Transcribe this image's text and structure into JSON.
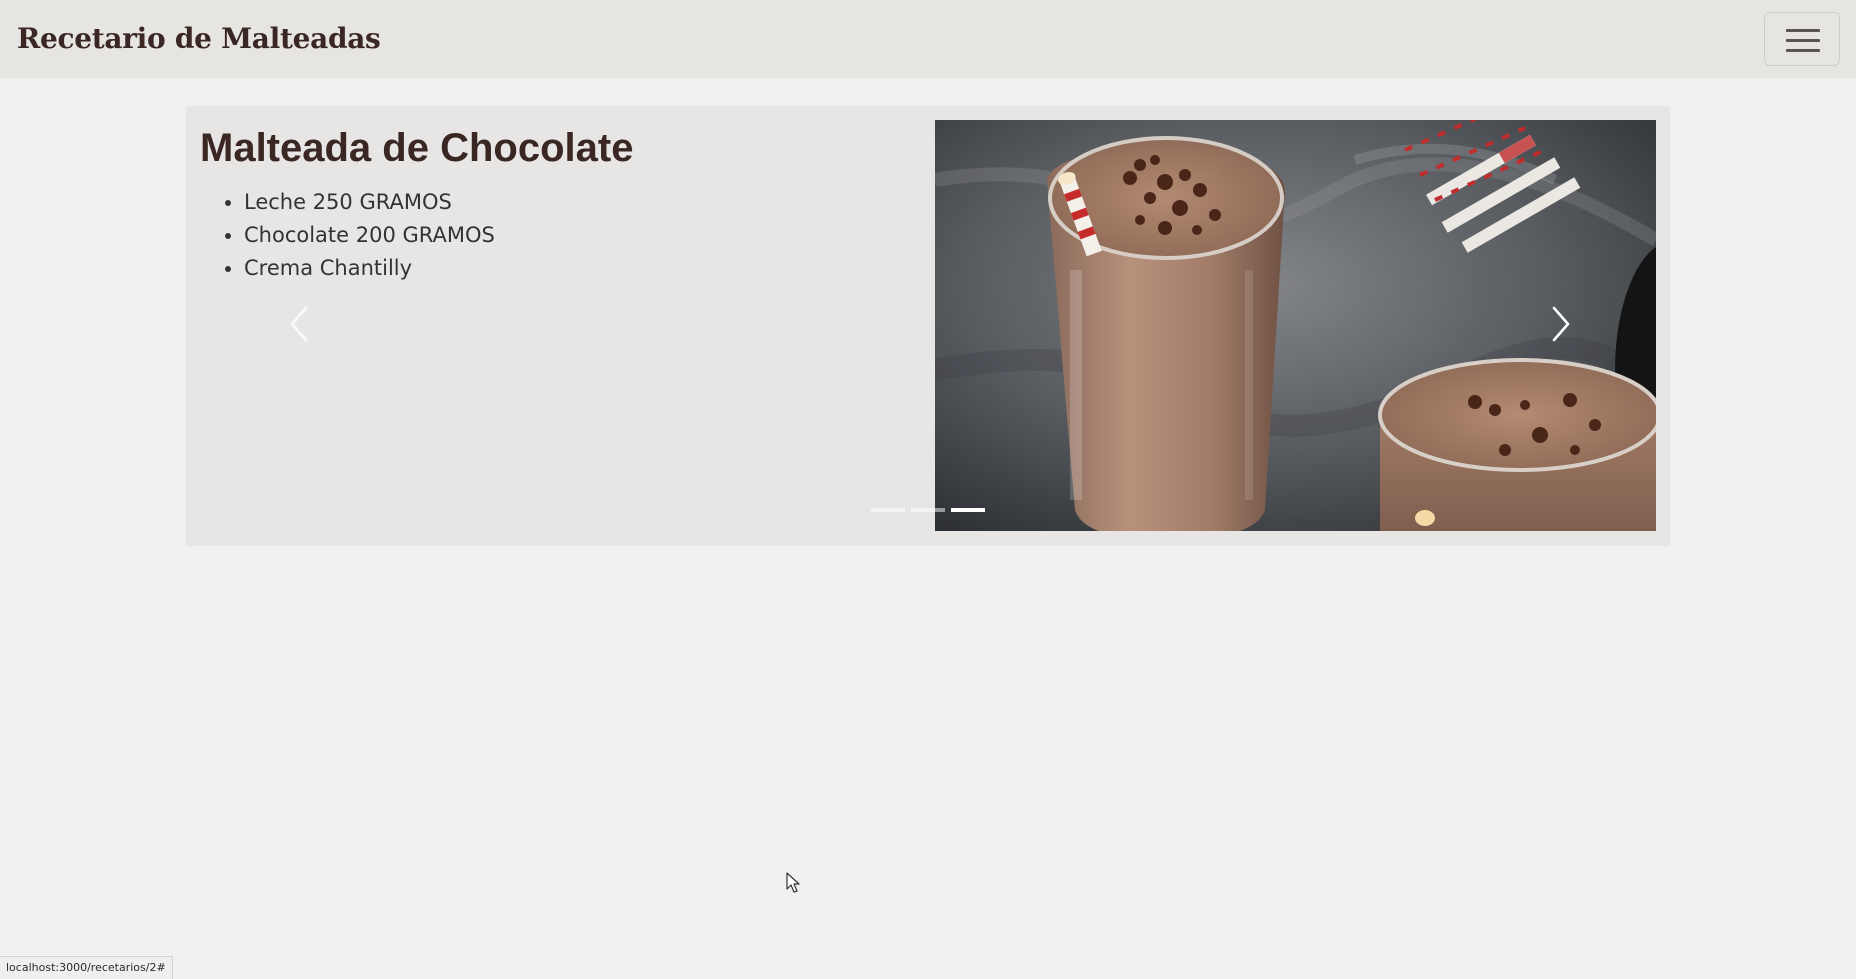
{
  "navbar": {
    "brand": "Recetario de Malteadas",
    "toggler_icon": "hamburger-menu-icon"
  },
  "carousel": {
    "active_index": 2,
    "slide_count": 3,
    "recipe": {
      "title": "Malteada de Chocolate",
      "ingredients": [
        "Leche 250 GRAMOS",
        "Chocolate 200 GRAMOS",
        "Crema Chantilly"
      ]
    },
    "prev_icon": "chevron-left-icon",
    "next_icon": "chevron-right-icon"
  },
  "status_bar": {
    "url": "localhost:3000/recetarios/2#"
  },
  "colors": {
    "text_dark": "#3a2623",
    "navbar_bg": "#e6e5e2",
    "page_bg": "#f2f1ef",
    "card_bg": "#e7e6e4"
  }
}
